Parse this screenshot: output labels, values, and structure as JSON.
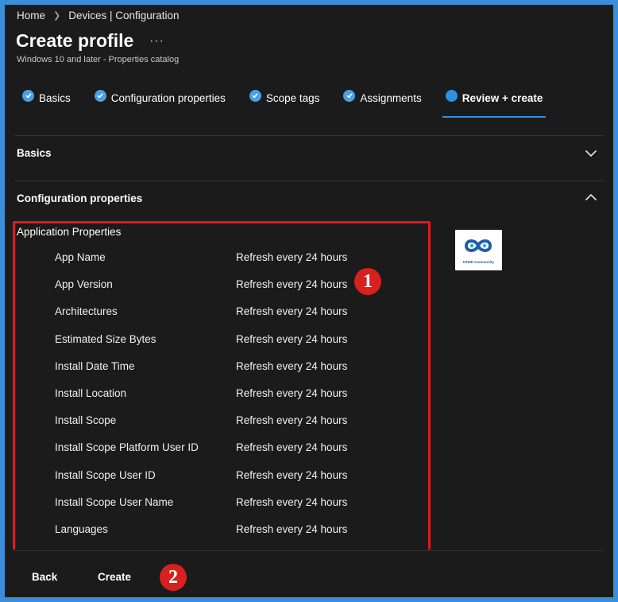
{
  "breadcrumb": {
    "home": "Home",
    "current": "Devices | Configuration"
  },
  "header": {
    "title": "Create profile",
    "more": "···",
    "subtitle": "Windows 10 and later - Properties catalog"
  },
  "wizard": {
    "steps": [
      {
        "label": "Basics",
        "state": "complete"
      },
      {
        "label": "Configuration properties",
        "state": "complete"
      },
      {
        "label": "Scope tags",
        "state": "complete"
      },
      {
        "label": "Assignments",
        "state": "complete"
      },
      {
        "label": "Review + create",
        "state": "active"
      }
    ]
  },
  "sections": {
    "basics": {
      "label": "Basics",
      "expanded": false
    },
    "configuration": {
      "label": "Configuration properties",
      "expanded": true
    }
  },
  "config": {
    "group_title": "Application Properties",
    "properties": [
      {
        "name": "App Name",
        "value": "Refresh every 24 hours"
      },
      {
        "name": "App Version",
        "value": "Refresh every 24 hours"
      },
      {
        "name": "Architectures",
        "value": "Refresh every 24 hours"
      },
      {
        "name": "Estimated Size Bytes",
        "value": "Refresh every 24 hours"
      },
      {
        "name": "Install Date Time",
        "value": "Refresh every 24 hours"
      },
      {
        "name": "Install Location",
        "value": "Refresh every 24 hours"
      },
      {
        "name": "Install Scope",
        "value": "Refresh every 24 hours"
      },
      {
        "name": "Install Scope Platform User ID",
        "value": "Refresh every 24 hours"
      },
      {
        "name": "Install Scope User ID",
        "value": "Refresh every 24 hours"
      },
      {
        "name": "Install Scope User Name",
        "value": "Refresh every 24 hours"
      },
      {
        "name": "Languages",
        "value": "Refresh every 24 hours"
      }
    ]
  },
  "annotations": {
    "badge1": "1",
    "badge2": "2"
  },
  "logo": {
    "text": "HTMD Community"
  },
  "footer": {
    "back_label": "Back",
    "create_label": "Create"
  },
  "colors": {
    "accent": "#2f8fe3",
    "highlight": "#e0191e",
    "background": "#1b1b1b",
    "outer_border": "#3b8fd9"
  }
}
